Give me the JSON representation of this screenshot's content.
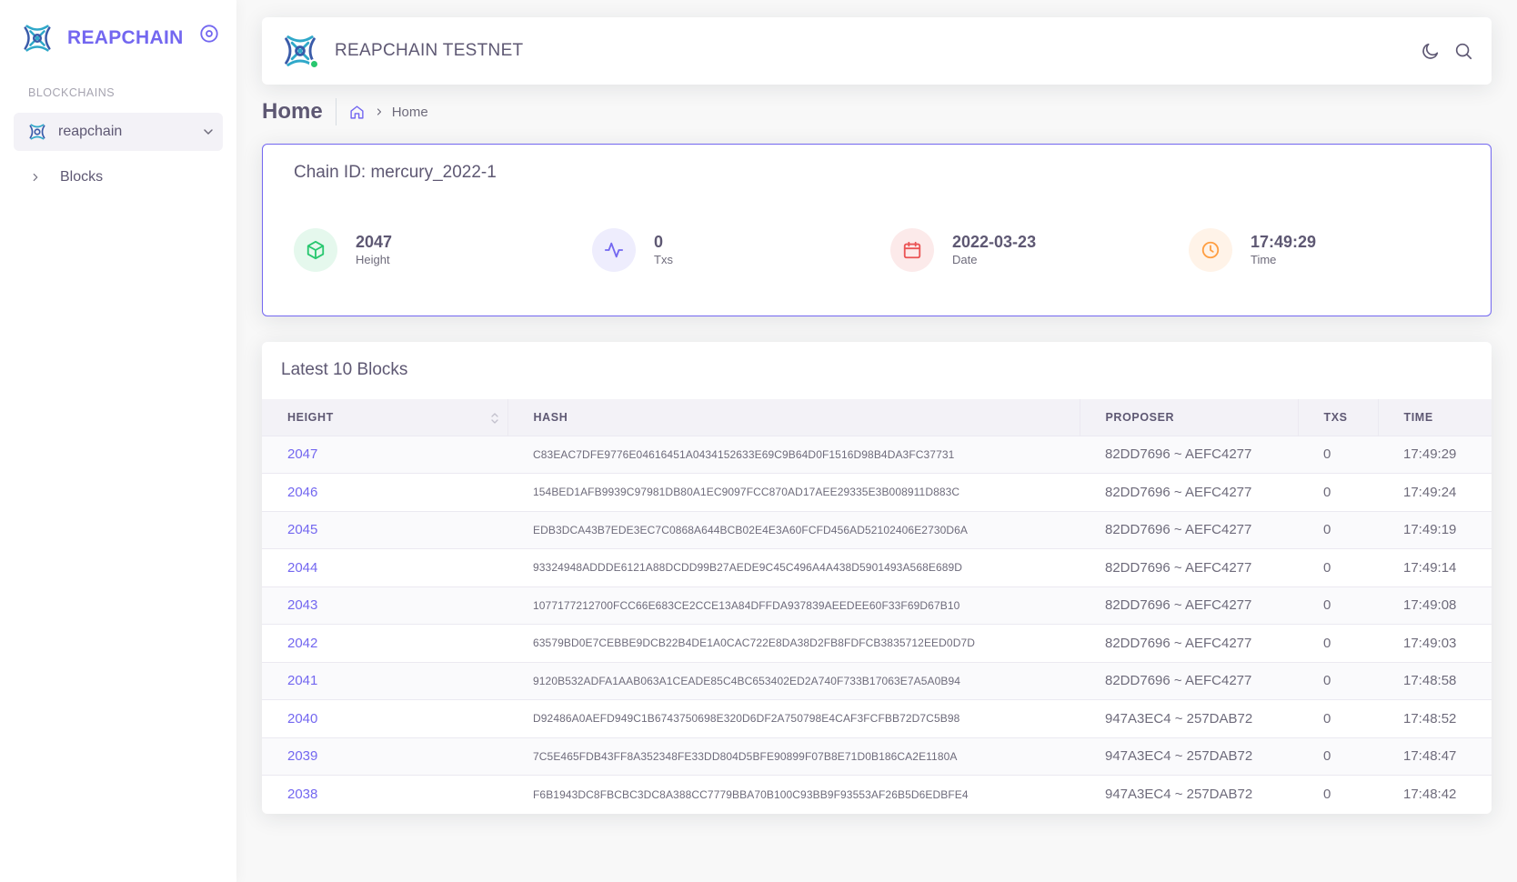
{
  "sidebar": {
    "brand": "REAPCHAIN",
    "section_header": "BLOCKCHAINS",
    "chain_item": "reapchain",
    "blocks_item": "Blocks"
  },
  "topbar": {
    "title": "REAPCHAIN TESTNET"
  },
  "breadcrumb": {
    "page_title": "Home",
    "current": "Home"
  },
  "chain_card": {
    "chain_id_label": "Chain ID: mercury_2022-1",
    "stats": [
      {
        "value": "2047",
        "label": "Height",
        "icon": "cube-icon",
        "color": "#28c76f"
      },
      {
        "value": "0",
        "label": "Txs",
        "icon": "activity-icon",
        "color": "#7367f0"
      },
      {
        "value": "2022-03-23",
        "label": "Date",
        "icon": "calendar-icon",
        "color": "#ea5455"
      },
      {
        "value": "17:49:29",
        "label": "Time",
        "icon": "clock-icon",
        "color": "#ff9f43"
      }
    ]
  },
  "blocks": {
    "title": "Latest 10 Blocks",
    "columns": [
      "HEIGHT",
      "HASH",
      "PROPOSER",
      "TXS",
      "TIME"
    ],
    "rows": [
      {
        "height": "2047",
        "hash": "C83EAC7DFE9776E04616451A0434152633E69C9B64D0F1516D98B4DA3FC37731",
        "proposer": "82DD7696 ~ AEFC4277",
        "txs": "0",
        "time": "17:49:29"
      },
      {
        "height": "2046",
        "hash": "154BED1AFB9939C97981DB80A1EC9097FCC870AD17AEE29335E3B008911D883C",
        "proposer": "82DD7696 ~ AEFC4277",
        "txs": "0",
        "time": "17:49:24"
      },
      {
        "height": "2045",
        "hash": "EDB3DCA43B7EDE3EC7C0868A644BCB02E4E3A60FCFD456AD52102406E2730D6A",
        "proposer": "82DD7696 ~ AEFC4277",
        "txs": "0",
        "time": "17:49:19"
      },
      {
        "height": "2044",
        "hash": "93324948ADDDE6121A88DCDD99B27AEDE9C45C496A4A438D5901493A568E689D",
        "proposer": "82DD7696 ~ AEFC4277",
        "txs": "0",
        "time": "17:49:14"
      },
      {
        "height": "2043",
        "hash": "1077177212700FCC66E683CE2CCE13A84DFFDA937839AEEDEE60F33F69D67B10",
        "proposer": "82DD7696 ~ AEFC4277",
        "txs": "0",
        "time": "17:49:08"
      },
      {
        "height": "2042",
        "hash": "63579BD0E7CEBBE9DCB22B4DE1A0CAC722E8DA38D2FB8FDFCB3835712EED0D7D",
        "proposer": "82DD7696 ~ AEFC4277",
        "txs": "0",
        "time": "17:49:03"
      },
      {
        "height": "2041",
        "hash": "9120B532ADFA1AAB063A1CEADE85C4BC653402ED2A740F733B17063E7A5A0B94",
        "proposer": "82DD7696 ~ AEFC4277",
        "txs": "0",
        "time": "17:48:58"
      },
      {
        "height": "2040",
        "hash": "D92486A0AEFD949C1B6743750698E320D6DF2A750798E4CAF3FCFBB72D7C5B98",
        "proposer": "947A3EC4 ~ 257DAB72",
        "txs": "0",
        "time": "17:48:52"
      },
      {
        "height": "2039",
        "hash": "7C5E465FDB43FF8A352348FE33DD804D5BFE90899F07B8E71D0B186CA2E1180A",
        "proposer": "947A3EC4 ~ 257DAB72",
        "txs": "0",
        "time": "17:48:47"
      },
      {
        "height": "2038",
        "hash": "F6B1943DC8FBCBC3DC8A388CC7779BBA70B100C93BB9F93553AF26B5D6EDBFE4",
        "proposer": "947A3EC4 ~ 257DAB72",
        "txs": "0",
        "time": "17:48:42"
      }
    ]
  }
}
